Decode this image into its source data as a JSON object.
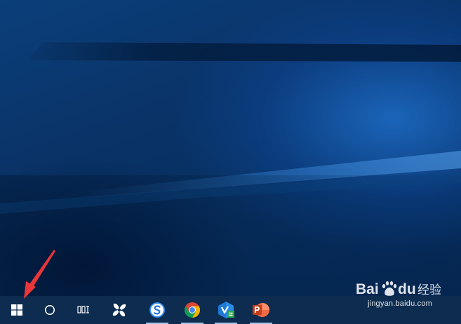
{
  "desktop": {
    "wallpaper": "windows-10-hero-blue",
    "colors": {
      "wallpaper_base": "#062a55",
      "wallpaper_light": "#1e6ec8",
      "taskbar": "#0d2c4f",
      "active_indicator": "#a7c4e4",
      "annotation": "#e8363b"
    }
  },
  "taskbar": {
    "system_buttons": [
      {
        "icon": "windows-logo-icon"
      },
      {
        "icon": "cortana-circle-icon"
      },
      {
        "icon": "task-view-icon"
      }
    ],
    "pinned_apps": [
      {
        "icon": "pinwheel-app-icon",
        "running": false
      },
      {
        "icon": "sogou-browser-icon",
        "running": true
      },
      {
        "icon": "chrome-icon",
        "running": true
      },
      {
        "icon": "visual-studio-code-icon",
        "running": true
      },
      {
        "icon": "powerpoint-icon",
        "running": true
      }
    ]
  },
  "watermark": {
    "logo_text": "Bai du 经验",
    "url": "jingyan.baidu.com"
  }
}
